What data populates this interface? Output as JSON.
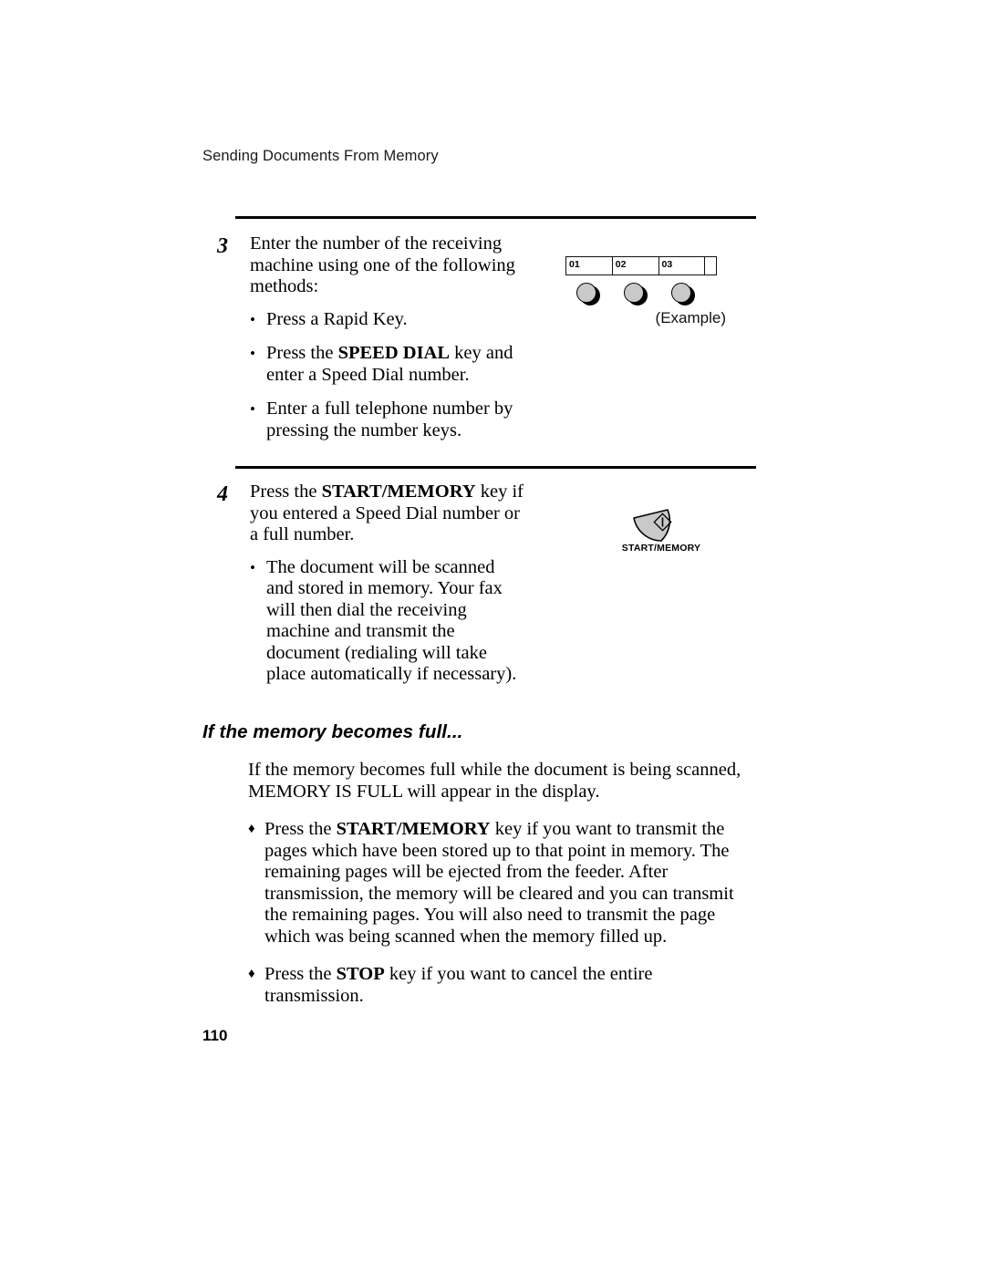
{
  "header": {
    "running_title": "Sending Documents From Memory"
  },
  "steps": [
    {
      "number": "3",
      "intro_before": "Enter the number of the receiving machine using one of the following methods:",
      "bullets": [
        {
          "prefix": "Press a Rapid Key.",
          "bold": "",
          "suffix": ""
        },
        {
          "prefix": "Press the ",
          "bold": "SPEED DIAL",
          "suffix": " key and enter a Speed Dial number."
        },
        {
          "prefix": "Enter a full telephone number by pressing the number keys.",
          "bold": "",
          "suffix": ""
        }
      ]
    },
    {
      "number": "4",
      "intro_prefix": "Press the ",
      "intro_bold": "START/MEMORY",
      "intro_suffix": " key if you entered a Speed Dial number or a full number.",
      "bullets": [
        {
          "prefix": "The document will be scanned and stored in memory. Your fax will then dial the receiving machine and transmit the document (redialing will take place automatically if necessary).",
          "bold": "",
          "suffix": ""
        }
      ]
    }
  ],
  "figures": {
    "rapid_key": {
      "cells": [
        "01",
        "02",
        "03"
      ],
      "caption": "(Example)"
    },
    "start_memory": {
      "label": "START/MEMORY"
    }
  },
  "section": {
    "heading": "If the memory becomes full...",
    "intro": "If the memory becomes full while the document is being scanned, MEMORY IS FULL will appear in the display.",
    "items": [
      {
        "prefix": "Press the ",
        "bold": "START/MEMORY",
        "suffix": " key if you want to transmit the pages which have been stored up to that point in memory. The remaining pages will be ejected from the feeder. After transmission, the memory will be cleared and you can transmit the remaining pages. You will also need to transmit the page which was being scanned when the memory filled up."
      },
      {
        "prefix": "Press the ",
        "bold": "STOP",
        "suffix": " key if you want to cancel the entire transmission."
      }
    ]
  },
  "footer": {
    "page_number": "110"
  },
  "glyphs": {
    "round_bullet": "•",
    "diamond_bullet": "♦"
  }
}
